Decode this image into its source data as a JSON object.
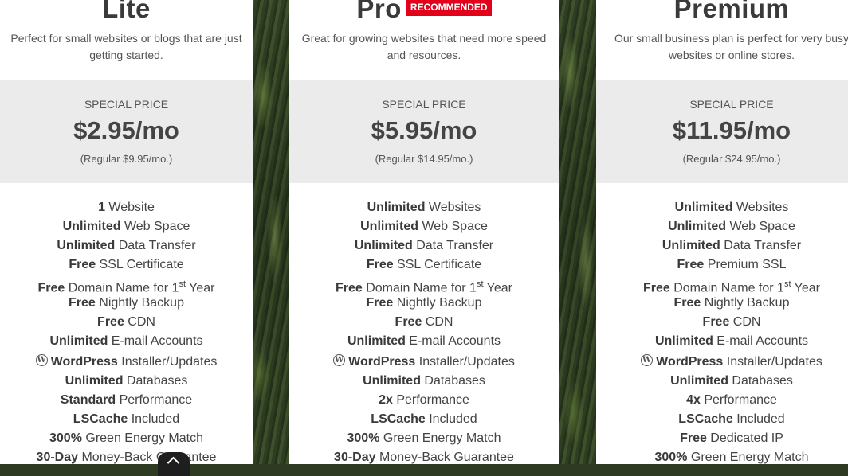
{
  "plans": [
    {
      "name": "Lite",
      "description": "Perfect for small websites or blogs that are just getting started.",
      "special_label": "SPECIAL PRICE",
      "price": "$2.95/mo",
      "regular": "(Regular $9.95/mo.)",
      "features": [
        {
          "bold": "1",
          "text": " Website"
        },
        {
          "bold": "Unlimited",
          "text": " Web Space"
        },
        {
          "bold": "Unlimited",
          "text": " Data Transfer"
        },
        {
          "bold": "Free",
          "text": " SSL Certificate"
        },
        {
          "bold": "Free",
          "text": " Domain Name for 1",
          "sup": "st",
          "after": " Year"
        },
        {
          "bold": "Free",
          "text": " Nightly Backup"
        },
        {
          "bold": "Free",
          "text": " CDN"
        },
        {
          "bold": "Unlimited",
          "text": " E-mail Accounts"
        },
        {
          "icon": "wordpress-icon",
          "bold": "WordPress",
          "text": " Installer/Updates"
        },
        {
          "bold": "Unlimited",
          "text": " Databases"
        },
        {
          "bold": "Standard",
          "text": " Performance"
        },
        {
          "bold": "LSCache",
          "text": " Included"
        },
        {
          "bold": "300%",
          "text": " Green Energy Match"
        },
        {
          "bold": "30-Day",
          "text": " Money-Back Guarantee"
        }
      ]
    },
    {
      "name": "Pro",
      "badge": "RECOMMENDED",
      "description": "Great for growing websites that need more speed and resources.",
      "special_label": "SPECIAL PRICE",
      "price": "$5.95/mo",
      "regular": "(Regular $14.95/mo.)",
      "features": [
        {
          "bold": "Unlimited",
          "text": " Websites"
        },
        {
          "bold": "Unlimited",
          "text": " Web Space"
        },
        {
          "bold": "Unlimited",
          "text": " Data Transfer"
        },
        {
          "bold": "Free",
          "text": " SSL Certificate"
        },
        {
          "bold": "Free",
          "text": " Domain Name for 1",
          "sup": "st",
          "after": " Year"
        },
        {
          "bold": "Free",
          "text": " Nightly Backup"
        },
        {
          "bold": "Free",
          "text": " CDN"
        },
        {
          "bold": "Unlimited",
          "text": " E-mail Accounts"
        },
        {
          "icon": "wordpress-icon",
          "bold": "WordPress",
          "text": " Installer/Updates"
        },
        {
          "bold": "Unlimited",
          "text": " Databases"
        },
        {
          "bold": "2x",
          "text": " Performance"
        },
        {
          "bold": "LSCache",
          "text": " Included"
        },
        {
          "bold": "300%",
          "text": " Green Energy Match"
        },
        {
          "bold": "30-Day",
          "text": " Money-Back Guarantee"
        }
      ]
    },
    {
      "name": "Premium",
      "description": "Our small business plan is perfect for very busy websites or online stores.",
      "special_label": "SPECIAL PRICE",
      "price": "$11.95/mo",
      "regular": "(Regular $24.95/mo.)",
      "features": [
        {
          "bold": "Unlimited",
          "text": " Websites"
        },
        {
          "bold": "Unlimited",
          "text": " Web Space"
        },
        {
          "bold": "Unlimited",
          "text": " Data Transfer"
        },
        {
          "bold": "Free",
          "text": " Premium SSL"
        },
        {
          "bold": "Free",
          "text": " Domain Name for 1",
          "sup": "st",
          "after": " Year"
        },
        {
          "bold": "Free",
          "text": " Nightly Backup"
        },
        {
          "bold": "Free",
          "text": " CDN"
        },
        {
          "bold": "Unlimited",
          "text": " E-mail Accounts"
        },
        {
          "icon": "wordpress-icon",
          "bold": "WordPress",
          "text": " Installer/Updates"
        },
        {
          "bold": "Unlimited",
          "text": " Databases"
        },
        {
          "bold": "4x",
          "text": " Performance"
        },
        {
          "bold": "LSCache",
          "text": " Included"
        },
        {
          "bold": "Free",
          "text": " Dedicated IP"
        },
        {
          "bold": "300%",
          "text": " Green Energy Match"
        }
      ]
    }
  ],
  "colors": {
    "badge": "#e3001b",
    "price_box": "#ebebeb"
  },
  "scroll_top_icon": "chevron-up-icon"
}
